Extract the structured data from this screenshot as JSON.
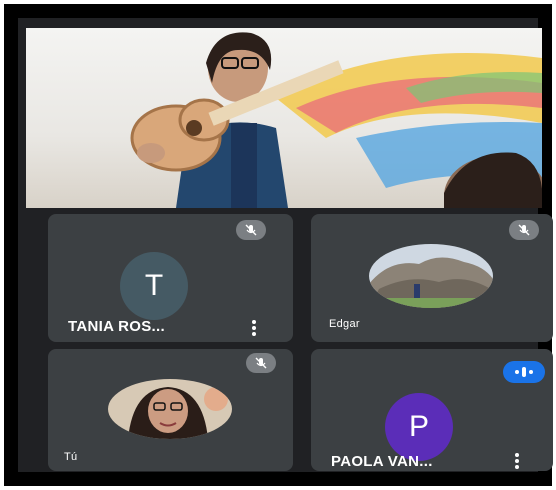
{
  "main_video": {
    "description_icon": "presenter-video"
  },
  "participants": [
    {
      "name": "TANIA ROS...",
      "avatar_letter": "T",
      "avatar_color": "#455a64",
      "muted": true,
      "menu_icon": "more-vert-icon"
    },
    {
      "name": "Edgar",
      "avatar_photo": "rocks-landscape",
      "muted": true
    },
    {
      "name": "Tú",
      "avatar_photo": "self-portrait",
      "muted": true
    },
    {
      "name": "PAOLA VAN...",
      "avatar_letter": "P",
      "avatar_color": "#5b2db8",
      "speaking": true,
      "menu_icon": "more-vert-icon"
    }
  ],
  "colors": {
    "background": "#202124",
    "tile": "#3c4043",
    "mic_badge": "#7b7f83",
    "speaking_badge": "#1a73e8"
  }
}
